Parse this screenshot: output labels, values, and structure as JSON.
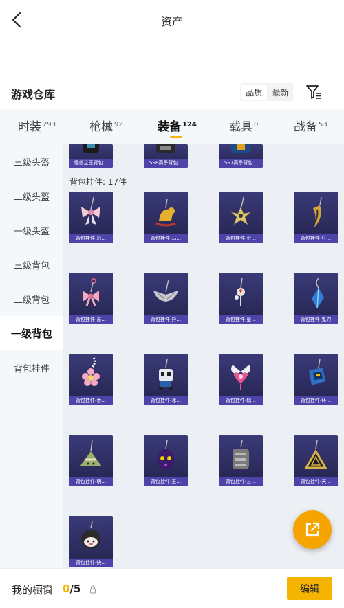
{
  "header": {
    "title": "资产"
  },
  "warehouse": {
    "title": "游戏仓库",
    "sort_options": [
      "品质",
      "最新"
    ]
  },
  "tabs": [
    {
      "label": "时装",
      "count": "293"
    },
    {
      "label": "枪械",
      "count": "92"
    },
    {
      "label": "装备",
      "count": "124",
      "active": true
    },
    {
      "label": "载具",
      "count": "0"
    },
    {
      "label": "战备",
      "count": "53"
    }
  ],
  "sidebar": {
    "items": [
      "三级头盔",
      "二级头盔",
      "一级头盔",
      "三级背包",
      "二级背包",
      "一级背包",
      "背包挂件"
    ],
    "active": "一级背包"
  },
  "top_partial_items": [
    "怪兽之王背包...",
    "SS8赛季背包...",
    "SS7赛季背包..."
  ],
  "group": {
    "label": "背包挂件: 17件",
    "items": [
      {
        "name": "背包挂件-彩...",
        "icon": "bow-charm-icon"
      },
      {
        "name": "背包挂件-马...",
        "icon": "horse-charm-icon"
      },
      {
        "name": "背包挂件-荒...",
        "icon": "star-charm-icon"
      },
      {
        "name": "背包挂件-狂...",
        "icon": "fang-charm-icon"
      },
      {
        "name": "背包挂件-蔷...",
        "icon": "ribbon-charm-icon"
      },
      {
        "name": "背包挂件-异...",
        "icon": "wing-charm-icon"
      },
      {
        "name": "背包挂件-星...",
        "icon": "heart-key-charm-icon"
      },
      {
        "name": "背包挂件-鬼刀",
        "icon": "crystal-charm-icon"
      },
      {
        "name": "背包挂件-香...",
        "icon": "flower-charm-icon"
      },
      {
        "name": "背包挂件-冰...",
        "icon": "robot-charm-icon"
      },
      {
        "name": "背包挂件-精...",
        "icon": "winged-heart-charm-icon"
      },
      {
        "name": "背包挂件-环...",
        "icon": "mech-charm-icon"
      },
      {
        "name": "背包挂件-萌...",
        "icon": "zongzi-charm-icon"
      },
      {
        "name": "背包挂件-王...",
        "icon": "egg-charm-icon"
      },
      {
        "name": "背包挂件-三...",
        "icon": "backpack-charm-icon"
      },
      {
        "name": "背包挂件-天...",
        "icon": "triangle-charm-icon"
      },
      {
        "name": "背包挂件-快...",
        "icon": "helmet-face-charm-icon"
      }
    ]
  },
  "showcase": {
    "label": "我的橱窗",
    "current": "0",
    "total": "/5"
  },
  "edit_label": "编辑",
  "colors": {
    "accent": "#f5b400",
    "card_bg": "#2e2e66",
    "caption_bg": "#4d43a8"
  }
}
